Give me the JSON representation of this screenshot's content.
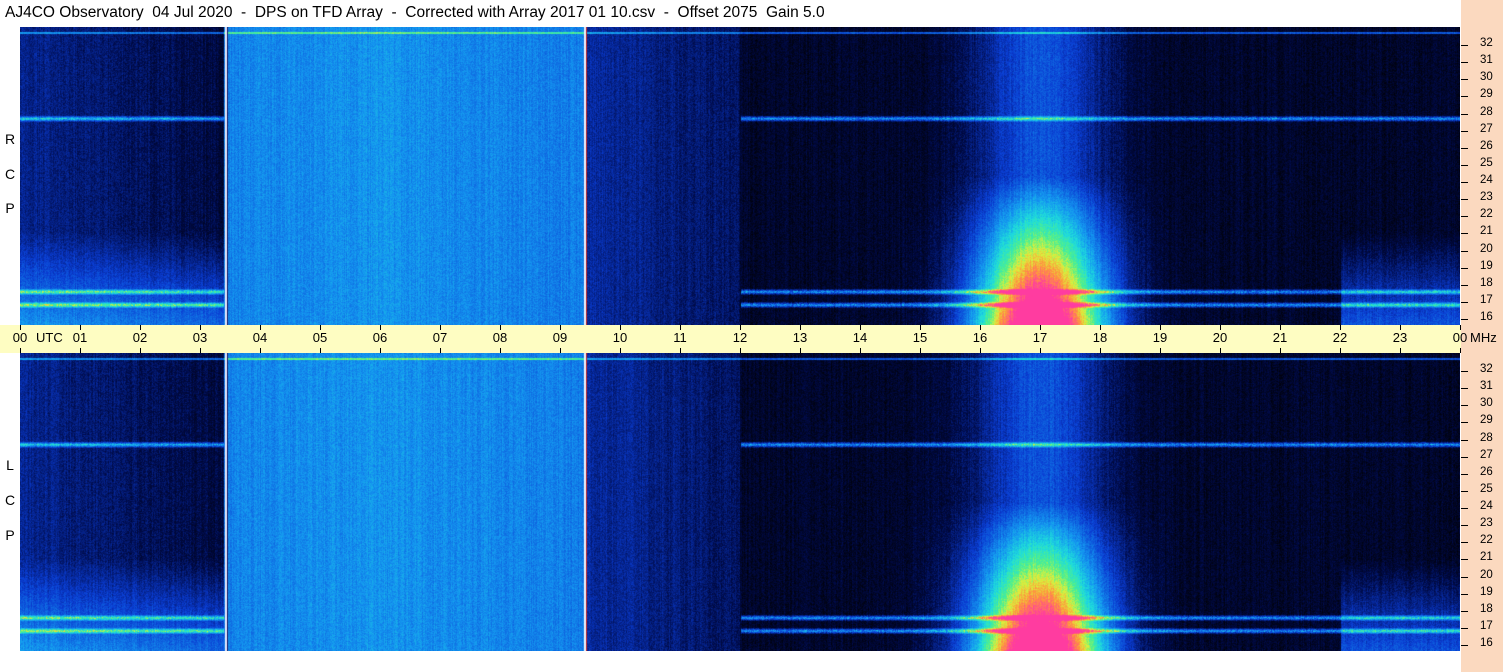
{
  "title": "AJ4CO Observatory  04 Jul 2020  -  DPS on TFD Array  -  Corrected with Array 2017 01 10.csv  -  Offset 2075  Gain 5.0",
  "panels": [
    {
      "name": "RCP",
      "letters": [
        "R",
        "C",
        "P"
      ]
    },
    {
      "name": "LCP",
      "letters": [
        "L",
        "C",
        "P"
      ]
    }
  ],
  "time_axis": {
    "labels": [
      "00",
      "01",
      "02",
      "03",
      "04",
      "05",
      "06",
      "07",
      "08",
      "09",
      "10",
      "11",
      "12",
      "13",
      "14",
      "15",
      "16",
      "17",
      "18",
      "19",
      "20",
      "21",
      "22",
      "23",
      "00"
    ],
    "unit": "UTC"
  },
  "freq_axis": {
    "labels": [
      "32",
      "31",
      "30",
      "29",
      "28",
      "27",
      "26",
      "25",
      "24",
      "23",
      "22",
      "21",
      "20",
      "19",
      "18",
      "17",
      "16"
    ],
    "unit": "MHz"
  },
  "colors": {
    "background": "#000000",
    "time_strip": "#fefdc2",
    "freq_strip": "#fbd9bf"
  },
  "chart_data": {
    "type": "heatmap",
    "title": "AJ4CO Observatory  04 Jul 2020  -  DPS on TFD Array  -  Corrected with Array 2017 01 10.csv  -  Offset 2075  Gain 5.0",
    "xlabel": "UTC",
    "ylabel": "MHz",
    "xlim": [
      0,
      24
    ],
    "ylim": [
      16,
      32
    ],
    "series": [
      {
        "name": "RCP",
        "peak_hour": 17.0,
        "peak_freq_range": [
          16,
          22
        ]
      },
      {
        "name": "LCP",
        "peak_hour": 17.0,
        "peak_freq_range": [
          16,
          22
        ]
      }
    ],
    "marker_hours": [
      3.42,
      9.4
    ],
    "bright_bands_mhz": [
      27.1,
      17.8,
      17.1
    ]
  }
}
